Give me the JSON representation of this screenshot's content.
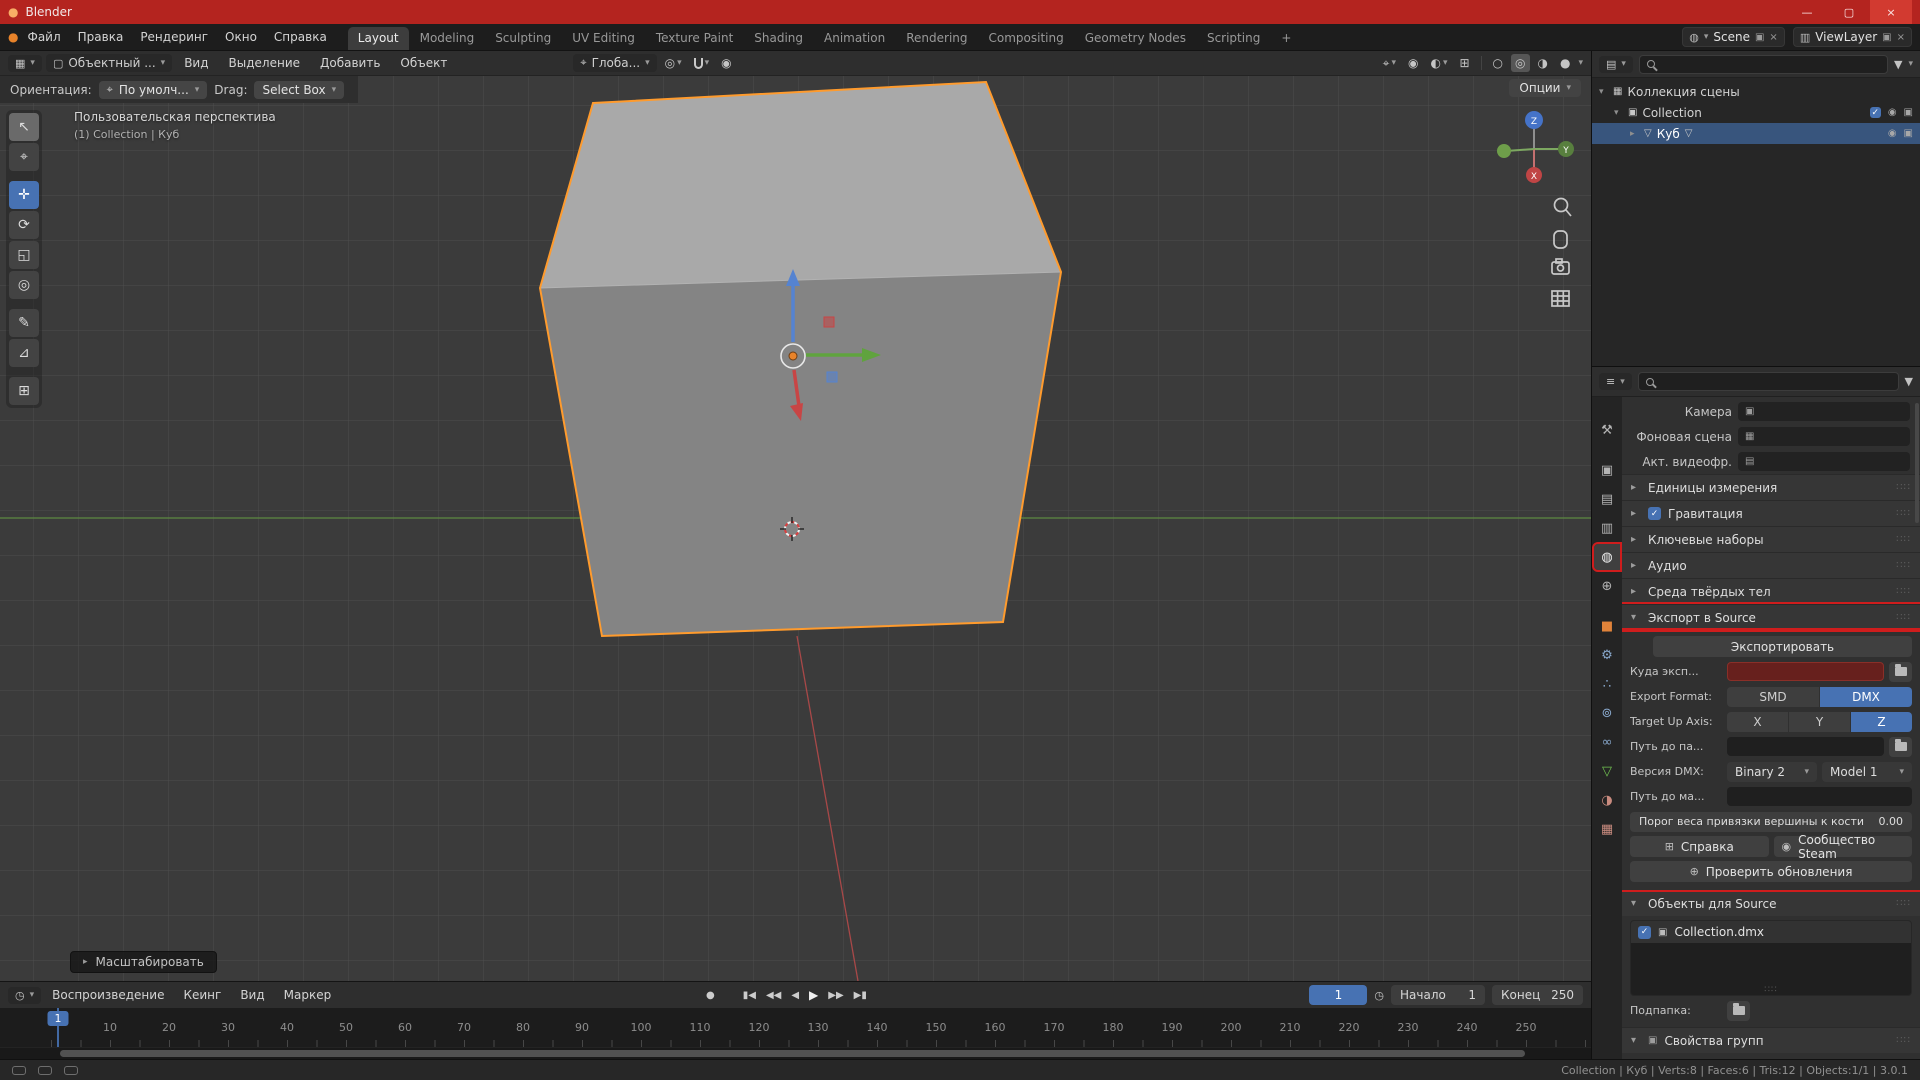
{
  "icons": {
    "dropdown": "▾",
    "expand_closed": "▸",
    "expand_open": "▾",
    "blender_logo": "●",
    "editor_3d": "▦",
    "editor_outliner": "▤",
    "editor_props": "≡",
    "editor_timeline": "◷",
    "mode_object": "▢",
    "orientation_axis": "⌖",
    "pivot": "◎",
    "proportional": "◉",
    "cursor_select": "⌖",
    "overlay": "◐",
    "xray": "⊞",
    "shade_wire": "○",
    "shade_solid": "◎",
    "shade_material": "◑",
    "shade_render": "●",
    "record": "●",
    "skip_start": "▮◀",
    "key_prev": "◀◀",
    "frame_prev": "◀",
    "play": "▶",
    "key_next": "▶▶",
    "skip_end": "▶▮",
    "clock": "◷",
    "filter": "▼",
    "scene_collection": "▦",
    "collection": "▣",
    "mesh_object": "▽",
    "mesh_data": "▽",
    "eye": "◉",
    "camera_restrict": "▣",
    "check": "✓",
    "dots": "∷∷",
    "tab_tool": "⚒",
    "tab_render": "▣",
    "tab_output": "▤",
    "tab_viewlayer": "▥",
    "tab_scene": "◍",
    "tab_world": "⊕",
    "tab_object": "■",
    "tab_modifiers": "⚙",
    "tab_particles": "∴",
    "tab_physics": "⊚",
    "tab_constraints": "∞",
    "tab_data": "▽",
    "tab_material": "◑",
    "tab_texture": "▦",
    "field_camera": "▣",
    "field_scene": "▦",
    "field_video": "▤",
    "help": "⊞",
    "steam": "◉",
    "globe": "⊕",
    "export_item": "▣",
    "new_copy": "▣",
    "close_x": "×"
  },
  "titlebar": {
    "title": "Blender",
    "minimize": "—",
    "maximize": "▢",
    "close": "×"
  },
  "menubar": {
    "menus": [
      "Файл",
      "Правка",
      "Рендеринг",
      "Окно",
      "Справка"
    ],
    "workspaces": [
      "Layout",
      "Modeling",
      "Sculpting",
      "UV Editing",
      "Texture Paint",
      "Shading",
      "Animation",
      "Rendering",
      "Compositing",
      "Geometry Nodes",
      "Scripting"
    ],
    "add_tab": "+",
    "scene": "Scene",
    "viewlayer": "ViewLayer"
  },
  "viewport_header": {
    "mode": "Объектный ...",
    "menus": [
      "Вид",
      "Выделение",
      "Добавить",
      "Объект"
    ],
    "orientation": "Глоба..."
  },
  "tool_settings": {
    "orientation_label": "Ориентация:",
    "orientation_value": "По умолч...",
    "drag_label": "Drag:",
    "drag_value": "Select Box",
    "options": "Опции"
  },
  "viewport": {
    "view_name": "Пользовательская перспектива",
    "active_info": "(1) Collection | Куб",
    "operator": "Масштабировать",
    "gizmo_x": "X",
    "gizmo_y": "Y",
    "gizmo_z": "Z"
  },
  "toolbar": {
    "tools": [
      {
        "name": "select-box",
        "glyph": "↖"
      },
      {
        "name": "cursor",
        "glyph": "⌖"
      },
      {
        "name": "move",
        "glyph": "✛"
      },
      {
        "name": "rotate",
        "glyph": "⟳"
      },
      {
        "name": "scale",
        "glyph": "◱"
      },
      {
        "name": "transform",
        "glyph": "◎"
      },
      {
        "name": "annotate",
        "glyph": "✎"
      },
      {
        "name": "measure",
        "glyph": "⊿"
      },
      {
        "name": "add-cube",
        "glyph": "⊞"
      }
    ]
  },
  "timeline": {
    "menus": [
      "Воспроизведение",
      "Кеинг",
      "Вид",
      "Маркер"
    ],
    "current_frame": "1",
    "marker": "1",
    "start_label": "Начало",
    "start_value": "1",
    "end_label": "Конец",
    "end_value": "250",
    "ticks": [
      "10",
      "20",
      "30",
      "40",
      "50",
      "60",
      "70",
      "80",
      "90",
      "100",
      "110",
      "120",
      "130",
      "140",
      "150",
      "160",
      "170",
      "180",
      "190",
      "200",
      "210",
      "220",
      "230",
      "240",
      "250"
    ]
  },
  "outliner": {
    "scene_collection": "Коллекция сцены",
    "collection": "Collection",
    "object": "Куб"
  },
  "properties": {
    "id_camera_label": "Камера",
    "id_bg_label": "Фоновая сцена",
    "id_video_label": "Акт. видеофр.",
    "panel_units": "Единицы измерения",
    "panel_gravity": "Гравитация",
    "panel_keying": "Ключевые наборы",
    "panel_audio": "Аудио",
    "panel_rigid": "Среда твёрдых тел",
    "export": {
      "title": "Экспорт в Source",
      "export_button": "Экспортировать",
      "dest_label": "Куда эксп...",
      "format_label": "Export Format:",
      "format_smd": "SMD",
      "format_dmx": "DMX",
      "axis_label": "Target Up Axis:",
      "axis_x": "X",
      "axis_y": "Y",
      "axis_z": "Z",
      "engine_path_label": "Путь до па...",
      "dmx_label": "Версия DMX:",
      "dmx_binary": "Binary 2",
      "dmx_model": "Model 1",
      "mat_path_label": "Путь до ма...",
      "weight_label": "Порог веса привязки вершины к кости",
      "weight_value": "0.00",
      "help_button": "Справка",
      "steam_button": "Сообщество Steam",
      "update_button": "Проверить обновления"
    },
    "objects": {
      "title": "Объекты для Source",
      "item": "Collection.dmx",
      "subfolder_label": "Подпапка:"
    },
    "groups": "Свойства групп"
  },
  "statusbar": {
    "info": "Collection | Куб | Verts:8 | Faces:6 | Tris:12 | Objects:1/1 | 3.0.1"
  }
}
